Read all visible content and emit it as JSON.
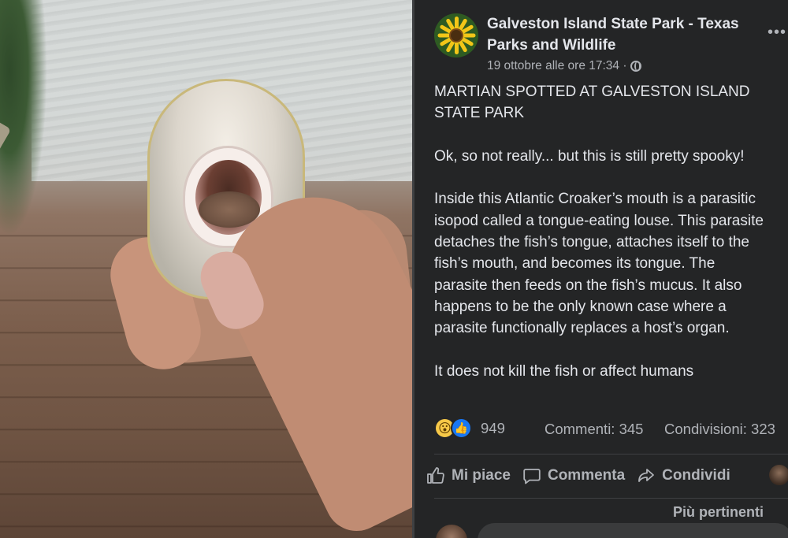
{
  "photo": {
    "alt_subject": "fish-with-tongue-eating-louse"
  },
  "post": {
    "page_name": "Galveston Island State Park - Texas Parks and Wildlife",
    "timestamp": "19 ottobre alle ore 17:34 ·",
    "more_label": "•••",
    "text_lines": [
      "MARTIAN SPOTTED AT GALVESTON ISLAND",
      "STATE PARK",
      "",
      "Ok, so not really... but this is still pretty spooky!",
      "",
      "Inside this Atlantic Croaker’s mouth is a parasitic",
      "isopod called a tongue-eating louse. This parasite",
      "detaches the fish’s tongue, attaches itself to the",
      "fish’s mouth, and becomes its tongue. The",
      "parasite then feeds on the fish’s mucus. It also",
      "happens to be the only known case where a",
      "parasite functionally replaces a host’s organ.",
      "",
      "It does not kill the fish or affect humans"
    ]
  },
  "stats": {
    "reaction_count": "949",
    "comments": "Commenti: 345",
    "shares": "Condivisioni: 323"
  },
  "actions": {
    "like": "Mi piace",
    "comment": "Commenta",
    "share": "Condividi"
  },
  "comments_section": {
    "sort_label": "Più pertinenti"
  },
  "colors": {
    "panel_bg": "#242526",
    "text_primary": "#e4e6eb",
    "text_secondary": "#b0b3b8",
    "like_blue": "#1877f2",
    "wow_yellow": "#f7c948"
  },
  "icons": [
    "globe-icon",
    "more-icon",
    "wow-reaction-icon",
    "like-reaction-icon",
    "like-icon",
    "comment-icon",
    "share-icon"
  ]
}
